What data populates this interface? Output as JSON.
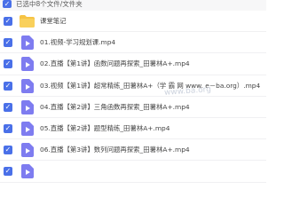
{
  "header": {
    "selection_text": "已选中8个文件/文件夹"
  },
  "watermark": "www.ba.org",
  "files": [
    {
      "name": "课堂笔记",
      "type": "folder"
    },
    {
      "name": "01.视频-学习规划课.mp4",
      "type": "video"
    },
    {
      "name": "02.直播【第1讲】函数问题再探索_田薯林A+.mp4",
      "type": "video"
    },
    {
      "name": "03.视频【第1讲】超常精练_田薯林A+（学 霸 网 www. e－ba.org）.mp4",
      "type": "video"
    },
    {
      "name": "04.直播【第2讲】三角函数再探索_田薯林A+.mp4",
      "type": "video"
    },
    {
      "name": "05.直播【第2讲】题型精练_田薯林A+.mp4",
      "type": "video"
    },
    {
      "name": "06.直播【第3讲】数列问题再探索_田薯林A+.mp4",
      "type": "video"
    },
    {
      "name": "",
      "type": "video"
    }
  ],
  "colors": {
    "accent": "#4a70e8",
    "video_icon": "#7e7cf0",
    "folder_icon": "#f6c344"
  }
}
